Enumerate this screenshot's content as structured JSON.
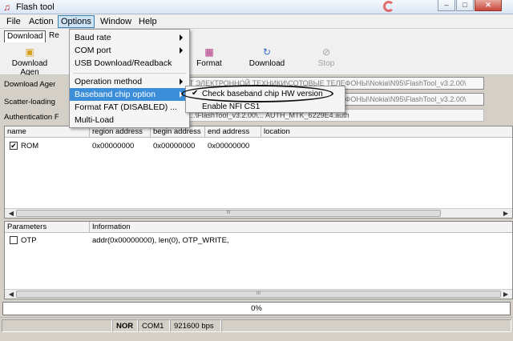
{
  "window": {
    "title": "Flash tool",
    "min": "–",
    "max": "□",
    "close": "✕",
    "icon": "flash-tool-icon"
  },
  "menubar": [
    "File",
    "Action",
    "Options",
    "Window",
    "Help"
  ],
  "tabs": [
    "Download",
    "Re"
  ],
  "toolbar": {
    "download_agent": "Download Agen",
    "format": "Format",
    "download": "Download",
    "stop": "Stop"
  },
  "fields": {
    "download_agent_label": "Download Agen",
    "download_agent_value": "Т ЭЛЕКТРОННОЙ ТЕХНИКИ\\СОТОВЫЕ ТЕЛЕФОНЫ\\Nokia\\N95\\FlashTool_v3.2.00\\",
    "scatter_label": "Scatter-loading f",
    "scatter_value": "Т ЭЛЕКТРОННОЙ ТЕХНИКИ\\СОТОВЫЕ ТЕЛЕФОНЫ\\Nokia\\N95\\FlashTool_v3.2.00\\",
    "auth_label": "Authentication F",
    "auth_value": "...\\FlashTool_v3.2.00\\... AUTH_MTK_6229E4.auth"
  },
  "table1": {
    "headers": [
      "name",
      "region address",
      "begin address",
      "end address",
      "location"
    ],
    "rows": [
      {
        "checked": true,
        "name": "ROM",
        "region": "0x00000000",
        "begin": "0x00000000",
        "end": "0x00000000",
        "location": ""
      }
    ]
  },
  "table2": {
    "headers": [
      "Parameters",
      "Information"
    ],
    "rows": [
      {
        "checked": false,
        "name": "OTP",
        "info": "addr(0x00000000), len(0), OTP_WRITE,"
      }
    ]
  },
  "progress": {
    "label": "0%",
    "value": 0
  },
  "status": {
    "flash": "NOR",
    "port": "COM1",
    "baud": "921600 bps"
  },
  "options_menu": {
    "items": [
      "Baud rate",
      "COM port",
      "USB Download/Readback",
      "Operation method",
      "Baseband chip option",
      "Format FAT (DISABLED) ...",
      "Multi-Load"
    ]
  },
  "baseband_submenu": {
    "items": [
      {
        "label": "Check baseband chip HW version",
        "checked": true
      },
      {
        "label": "Enable NFI CS1",
        "checked": false
      }
    ]
  },
  "scroll_grip": "III"
}
